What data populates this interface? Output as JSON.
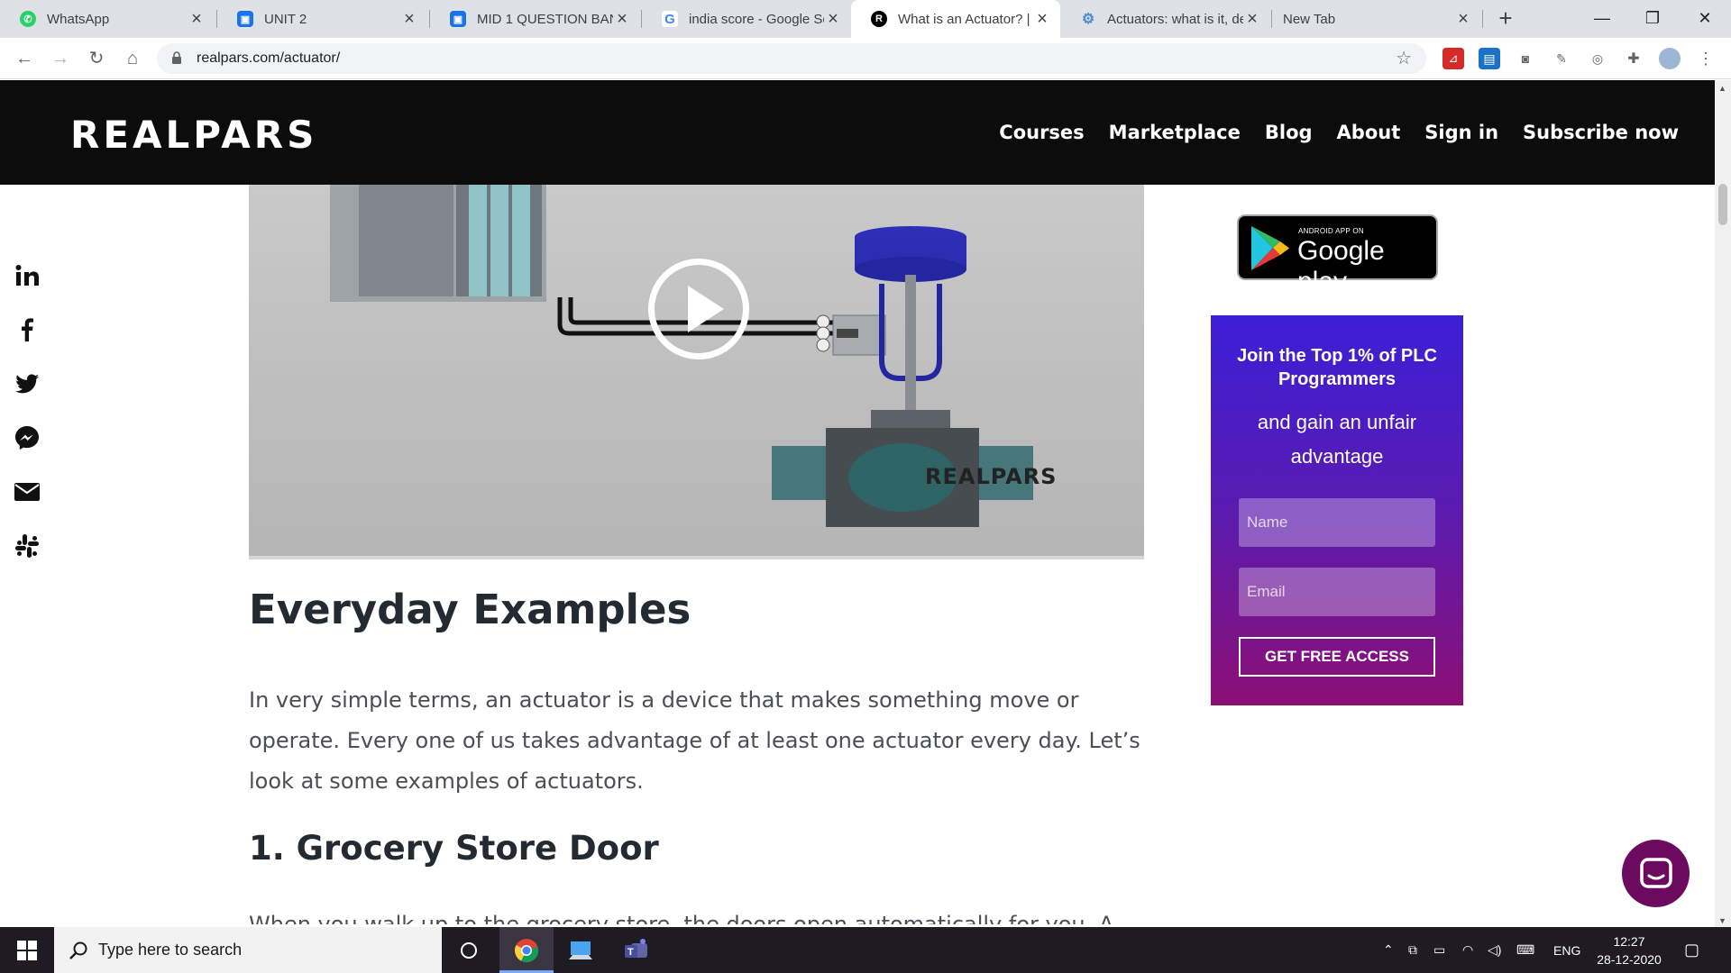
{
  "browser": {
    "tabs": [
      {
        "title": "WhatsApp",
        "icon": "whatsapp-icon",
        "color": "#25d366"
      },
      {
        "title": "UNIT 2",
        "icon": "google-classroom-icon",
        "color": "#1a73e8"
      },
      {
        "title": "MID 1 QUESTION BAN",
        "icon": "google-classroom-icon",
        "color": "#1a73e8"
      },
      {
        "title": "india score - Google Se",
        "icon": "google-icon",
        "color": "#4285f4"
      },
      {
        "title": "What is an Actuator? | R",
        "icon": "realpars-icon",
        "color": "#000000"
      },
      {
        "title": "Actuators: what is it, de",
        "icon": "gear-icon",
        "color": "#4e8bcf"
      },
      {
        "title": "New Tab",
        "icon": "",
        "color": ""
      }
    ],
    "active_tab_index": 4,
    "url": "realpars.com/actuator/"
  },
  "site": {
    "logo": "REALPARS",
    "nav": [
      "Courses",
      "Marketplace",
      "Blog",
      "About",
      "Sign in",
      "Subscribe now"
    ],
    "video_watermark": "REALPARS"
  },
  "article": {
    "heading": "Everyday Examples",
    "paragraph": "In very simple terms, an actuator is a device that makes something move or operate. Every one of us takes advantage of at least one actuator every day. Let’s look at some examples of actuators.",
    "subheading": "1. Grocery Store Door",
    "cut_text": "When you walk up to the grocery store, the doors open automatically for you. A contact"
  },
  "sidebar": {
    "gplay_small": "ANDROID APP ON",
    "gplay_big": "Google play",
    "promo_title": "Join the Top 1% of PLC Programmers",
    "promo_sub": "and gain an unfair advantage",
    "name_placeholder": "Name",
    "email_placeholder": "Email",
    "cta": "GET FREE ACCESS"
  },
  "taskbar": {
    "search_placeholder": "Type here to search",
    "lang": "ENG",
    "time": "12:27",
    "date": "28-12-2020"
  },
  "colors": {
    "header_bg": "#0c0c0c",
    "promo_top": "#3c1fd6",
    "promo_bottom": "#8c0f74",
    "chat": "#6b0a5e"
  }
}
